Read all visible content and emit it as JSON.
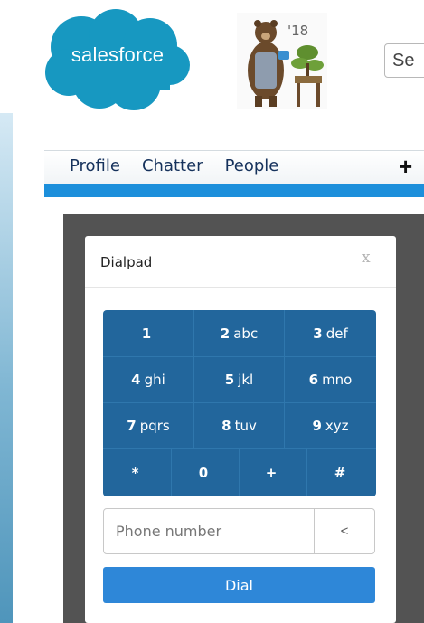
{
  "header": {
    "logo_text": "salesforce",
    "badge_year": "'18",
    "search_value": "Se"
  },
  "nav": {
    "tabs": [
      {
        "label": "Profile"
      },
      {
        "label": "Chatter"
      },
      {
        "label": "People"
      }
    ],
    "plus_label": "+"
  },
  "dialpad": {
    "title": "Dialpad",
    "close_label": "x",
    "keys": [
      {
        "digit": "1",
        "letters": ""
      },
      {
        "digit": "2",
        "letters": "abc"
      },
      {
        "digit": "3",
        "letters": "def"
      },
      {
        "digit": "4",
        "letters": "ghi"
      },
      {
        "digit": "5",
        "letters": "jkl"
      },
      {
        "digit": "6",
        "letters": "mno"
      },
      {
        "digit": "7",
        "letters": "pqrs"
      },
      {
        "digit": "8",
        "letters": "tuv"
      },
      {
        "digit": "9",
        "letters": "xyz"
      },
      {
        "digit": "*",
        "letters": ""
      },
      {
        "digit": "0",
        "letters": ""
      },
      {
        "digit": "+",
        "letters": ""
      },
      {
        "digit": "#",
        "letters": ""
      }
    ],
    "phone_placeholder": "Phone number",
    "backspace_label": "<",
    "dial_label": "Dial"
  },
  "colors": {
    "brand_blue": "#1c8fdb",
    "key_blue": "#22669c",
    "dial_blue": "#2e87d8",
    "console_gray": "#535353"
  },
  "icons": {
    "logo": "salesforce-cloud-logo",
    "mascot": "bear-gardener-icon",
    "add": "plus-icon",
    "close": "close-icon",
    "backspace": "backspace-icon"
  }
}
